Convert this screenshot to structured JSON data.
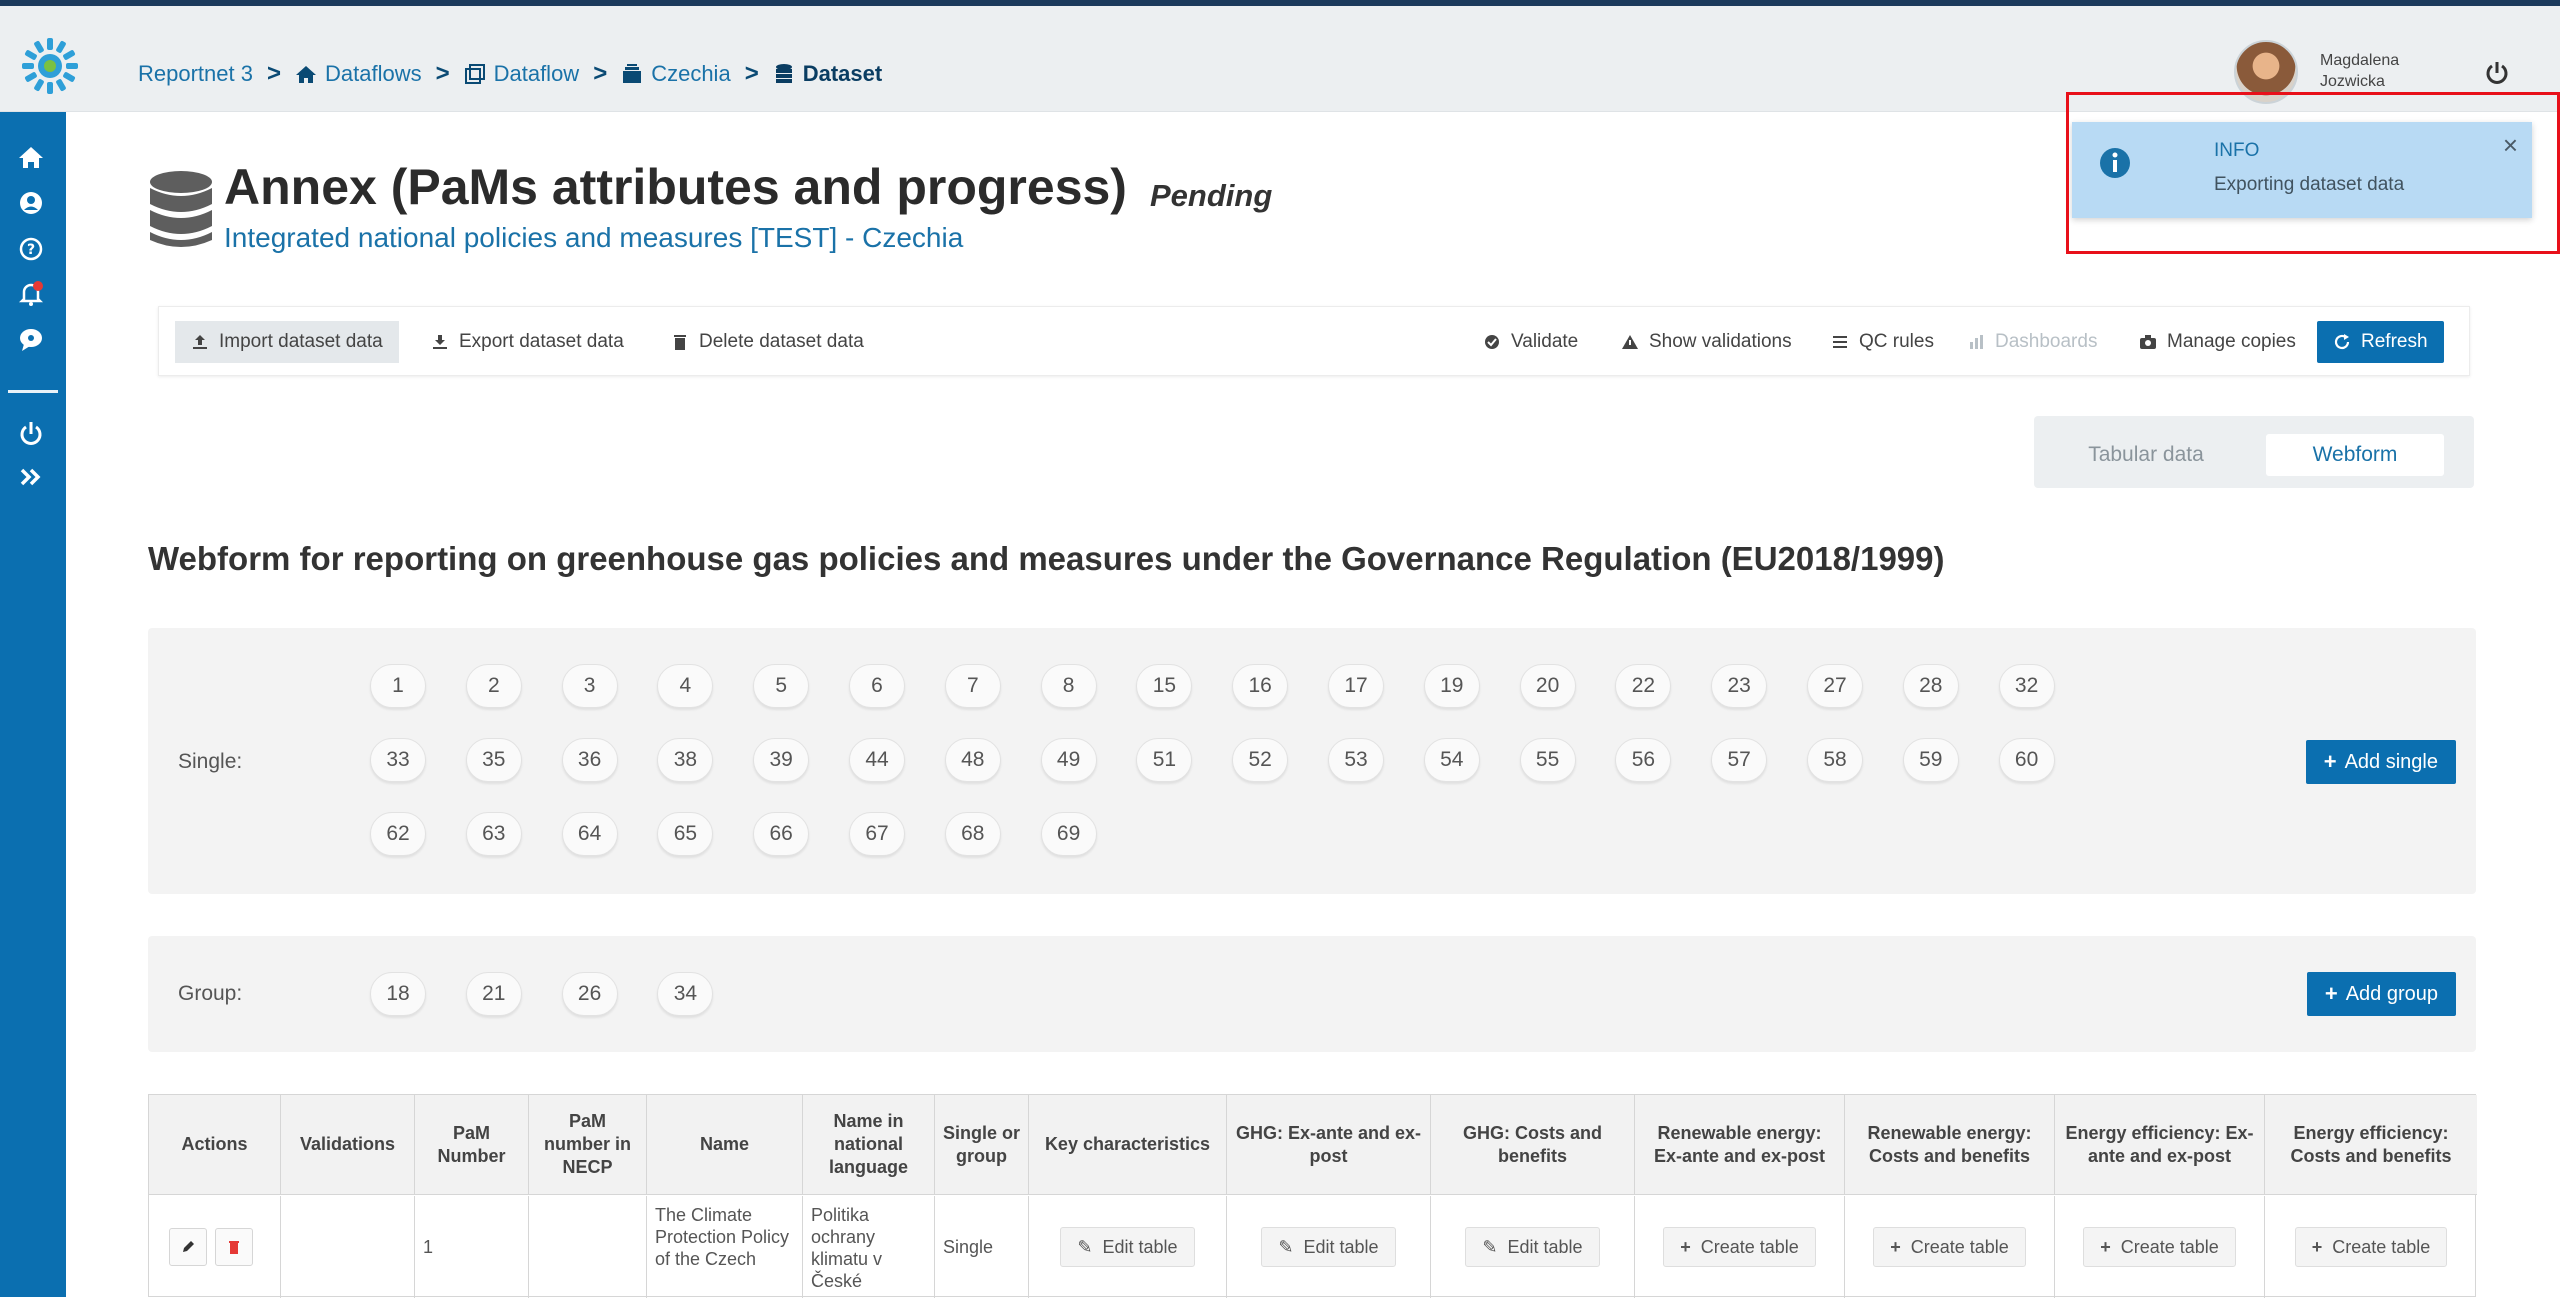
{
  "header": {
    "breadcrumb": [
      {
        "label": "Reportnet 3",
        "icon": "none"
      },
      {
        "label": "Dataflows",
        "icon": "home-icon"
      },
      {
        "label": "Dataflow",
        "icon": "clone-icon"
      },
      {
        "label": "Czechia",
        "icon": "folder-icon"
      },
      {
        "label": "Dataset",
        "icon": "database-icon"
      }
    ],
    "user_first": "Magdalena",
    "user_last": "Jozwicka"
  },
  "page": {
    "title": "Annex (PaMs attributes and progress)",
    "status": "Pending",
    "subtitle": "Integrated national policies and measures [TEST] - Czechia"
  },
  "toolbar": {
    "import": "Import dataset data",
    "export": "Export dataset data",
    "delete": "Delete dataset data",
    "validate": "Validate",
    "show_validations": "Show validations",
    "qc_rules": "QC rules",
    "dashboards": "Dashboards",
    "manage_copies": "Manage copies",
    "refresh": "Refresh"
  },
  "view_toggle": {
    "tabular": "Tabular data",
    "webform": "Webform"
  },
  "webform": {
    "title": "Webform for reporting on greenhouse gas policies and measures under the Governance Regulation (EU2018/1999)",
    "single_label": "Single:",
    "single_rows": [
      [
        "1",
        "2",
        "3",
        "4",
        "5",
        "6",
        "7",
        "8",
        "15",
        "16",
        "17",
        "19",
        "20",
        "22",
        "23",
        "27",
        "28",
        "32"
      ],
      [
        "33",
        "35",
        "36",
        "38",
        "39",
        "44",
        "48",
        "49",
        "51",
        "52",
        "53",
        "54",
        "55",
        "56",
        "57",
        "58",
        "59",
        "60"
      ],
      [
        "62",
        "63",
        "64",
        "65",
        "66",
        "67",
        "68",
        "69"
      ]
    ],
    "add_single": "Add single",
    "group_label": "Group:",
    "group_items": [
      "18",
      "21",
      "26",
      "34"
    ],
    "add_group": "Add group"
  },
  "table": {
    "headers": [
      "Actions",
      "Validations",
      "PaM Number",
      "PaM number in NECP",
      "Name",
      "Name in national language",
      "Single or group",
      "Key characteristics",
      "GHG: Ex-ante and ex-post",
      "GHG: Costs and benefits",
      "Renewable energy: Ex-ante and ex-post",
      "Renewable energy: Costs and benefits",
      "Energy efficiency: Ex-ante and ex-post",
      "Energy efficiency: Costs and benefits"
    ],
    "row": {
      "pam_number": "1",
      "name": "The Climate Protection Policy of the Czech",
      "name_national": "Politika ochrany klimatu v České",
      "single_or_group": "Single",
      "edit_label": "Edit table",
      "create_label": "Create table"
    }
  },
  "toast": {
    "title": "INFO",
    "message": "Exporting dataset data"
  },
  "colors": {
    "primary": "#0b6fb0",
    "toast_bg": "#b8daf4",
    "highlight": "#e8101a"
  }
}
